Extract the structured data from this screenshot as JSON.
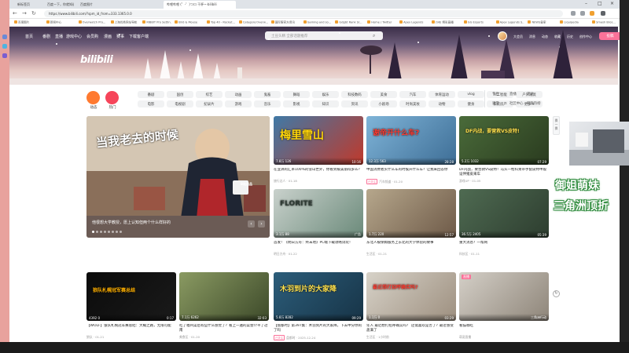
{
  "browser": {
    "tabs": [
      {
        "label": "新标签页"
      },
      {
        "label": "百度一下，你就知道"
      },
      {
        "label": "百度图片"
      },
      {
        "label": "哔哩哔哩 (゜-゜)つロ 干杯~-bilibili",
        "active": true
      }
    ],
    "url": "https://www.bilibili.com/?spm_id_from=333.1365.0.0",
    "bookmarks": [
      "百度图片",
      "新闻中心",
      "Overwatch Pro...",
      "上海优秀网址导航",
      "RIBBIT Pro Settin...",
      "Bird & Mouse",
      "Top 40 - Rocket...",
      "Category:Overw...",
      "国际服官方资讯",
      "Gaming and so...",
      "Gdgbt Rank Sr...",
      "Home / Twitter",
      "Apex Legends",
      "(98) 精彩直播",
      "GG Esports",
      "Apex Legends S...",
      "NEWS皇家",
      "Liquipedia",
      "Smash Bros..."
    ]
  },
  "site_nav": {
    "left": [
      "首页",
      "番剧",
      "直播",
      "游戏中心",
      "会员购",
      "漫画",
      "赛事",
      "下载客户端"
    ],
    "search_placeholder": "土豆头精 全部话题推荐",
    "right": [
      "大会员",
      "消息",
      "动态",
      "收藏",
      "历史",
      "创作中心"
    ],
    "upload_label": "投稿",
    "logo_text": "bilibili"
  },
  "channels": {
    "primary": [
      {
        "label": "动态",
        "color": "#ff7a30"
      },
      {
        "label": "热门",
        "color": "#f6455a"
      }
    ],
    "row1": [
      "番剧",
      "国创",
      "综艺",
      "动画",
      "鬼畜",
      "舞蹈",
      "娱乐",
      "科技数码",
      "美食",
      "汽车",
      "体育运动",
      "vlog",
      "人工智能",
      "户外潮流"
    ],
    "row2": [
      "电影",
      "电视剧",
      "纪录片",
      "游戏",
      "音乐",
      "影视",
      "知识",
      "资讯",
      "小剧场",
      "时尚美妆",
      "动物",
      "健身",
      "家装房产",
      "更多 ▾"
    ],
    "right_links": [
      "专栏",
      "直播",
      "活动",
      "课堂",
      "社区中心",
      "新歌热榜"
    ]
  },
  "hero": {
    "caption": "他很想大学教授，愿上认知但两个什么样好的",
    "logo_badge": "B站出品",
    "overlay_text": "当我老去的时候",
    "dots": 8,
    "arrows": [
      "‹",
      "›"
    ]
  },
  "cards": [
    {
      "title": "在亚洲的汇率100%的雪山世外，你看到被美丽得多么？",
      "author": "旅行达人 · 01-18",
      "views": "7.8万",
      "danmaku": "126",
      "duration": "10:16",
      "thumb_text": "梅里雪山",
      "thumb_colors": [
        "#3f79a6",
        "#c0392b"
      ],
      "text_color": "#ffd60a"
    },
    {
      "title": "中国消费者买什么车的时候开什么车？让我来回答你",
      "author": "汽车频道 · 01-20",
      "views": "12.3万",
      "danmaku": "563",
      "duration": "28:28",
      "thumb_text": "谢帝开什么车?",
      "thumb_colors": [
        "#7fb4d8",
        "#3e6e96"
      ],
      "text_color": "#ff3b30",
      "badge": "已关注"
    },
    {
      "title": "DF内战，要营救VS皮特！马头一枪科莱带手套皮特甲般设伸猪皮来车",
      "author": "游戏UP · 01-05",
      "views": "5.2万",
      "danmaku": "1032",
      "duration": "07:29",
      "thumb_text": "DF内战，要营救VS皮特!",
      "thumb_colors": [
        "#4a6b3a",
        "#2a3b1f"
      ],
      "text_color": "#ffe14d"
    },
    {
      "title": "首发！《明日方舟：终末地》PC端下载攻略试玩！",
      "author": "明日方舟 · 01-22",
      "views": "3.1万",
      "danmaku": "88",
      "duration": "广告",
      "thumb_text": "FLORITE",
      "thumb_colors": [
        "#c9d1cc",
        "#6b8a7a"
      ],
      "text_color": "#2e3b34"
    },
    {
      "title": "东北人被保姆服务上东北的大学体验的故事",
      "author": "生活区 · 01-21",
      "views": "1.7万",
      "danmaku": "220",
      "duration": "12:57",
      "thumb_text": "",
      "thumb_colors": [
        "#b6a78c",
        "#6e5a48"
      ],
      "text_color": "#fff"
    },
    {
      "title": "重大消息？一帮网",
      "author": "科技区 · 01-11",
      "views": "36.5万",
      "danmaku": "2405",
      "duration": "05:39",
      "thumb_text": "",
      "thumb_colors": [
        "#4f6b52",
        "#2d3d2f"
      ],
      "text_color": "#fff"
    },
    {
      "title": "【WOLF】狼队札幌冠军赛总结：大概之路，无限可能",
      "author": "狼队 · 01-21",
      "views": "4392",
      "danmaku": "0",
      "duration": "0:17",
      "thumb_text": "狼队札幌冠军赛总结",
      "thumb_colors": [
        "#0b0b0b",
        "#1a1a1a"
      ],
      "text_color": "#ffb000"
    },
    {
      "title": "吃了福州菜后有些什么感觉了？看上一遍的菜会介平了过南",
      "author": "美食区 · 01-20",
      "views": "7.1万",
      "danmaku": "6262",
      "duration": "32:03",
      "thumb_text": "",
      "thumb_colors": [
        "#8a9a62",
        "#3d4a2a"
      ],
      "text_color": "#fff"
    },
    {
      "title": "【盘都时】第397集：木羽到片的大家降，下去中分你的了吗",
      "author": "盘都时 · 2025-12-24",
      "views": "5.8万",
      "danmaku": "8282",
      "duration": "09:29",
      "thumb_text": "木羽到片的大家降",
      "thumb_colors": [
        "#2c5d7a",
        "#173447"
      ],
      "text_color": "#ffe14d",
      "badge": "已关注"
    },
    {
      "title": "年人 最近想打招呼确实吗？ 还需喜欢是否了？最近感受盖满了",
      "author": "生活区 · 1小时前",
      "views": "1.1万",
      "danmaku": "0",
      "duration": "03:29",
      "thumb_text": "最近想打招呼确实吗?",
      "thumb_colors": [
        "#d7d2c8",
        "#9d8f7f"
      ],
      "text_color": "#ff3b30"
    },
    {
      "title": "看猫咖吃",
      "author": "萌宠直播",
      "views": "",
      "danmaku": "",
      "duration": "三角洲行动",
      "thumb_text": "",
      "thumb_colors": [
        "#d4cfc7",
        "#8e8579"
      ],
      "text_color": "#fff",
      "live": "直播"
    }
  ],
  "side": {
    "refresh_label": "换一换"
  },
  "overlay": {
    "line1": "御姐萌妹",
    "line2": "三角洲顶折"
  }
}
